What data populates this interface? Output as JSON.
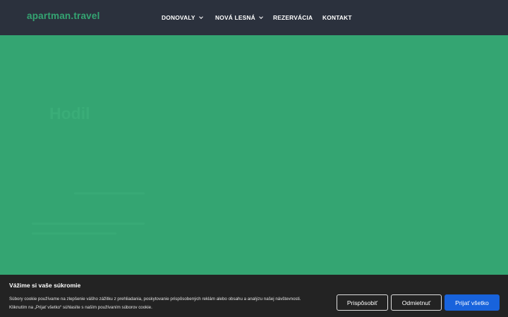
{
  "header": {
    "logo": "apartman.travel",
    "nav": [
      {
        "label": "DONOVALY",
        "has_dropdown": true
      },
      {
        "label": "NOVÁ LESNÁ",
        "has_dropdown": true
      },
      {
        "label": "REZERVÁCIA",
        "has_dropdown": false
      },
      {
        "label": "KONTAKT",
        "has_dropdown": false
      }
    ]
  },
  "hero": {
    "faint_heading": "Hodil"
  },
  "cookie_banner": {
    "title": "Vážime si vaše súkromie",
    "text_line1": "Súbory cookie používame na zlepšenie vášho zážitku z prehliadania, poskytovanie prispôsobených reklám alebo obsahu a analýzu našej návštevnosti.",
    "text_line2": "Kliknutím na „Prijať všetko“ súhlasíte s naším používaním súborov cookie.",
    "customize_label": "Prispôsobiť",
    "reject_label": "Odmietnuť",
    "accept_label": "Prijať všetko"
  },
  "colors": {
    "brand": "#34a572",
    "header_bg": "#2b313d",
    "banner_bg": "#232323",
    "accept_bg": "#1863dc"
  }
}
